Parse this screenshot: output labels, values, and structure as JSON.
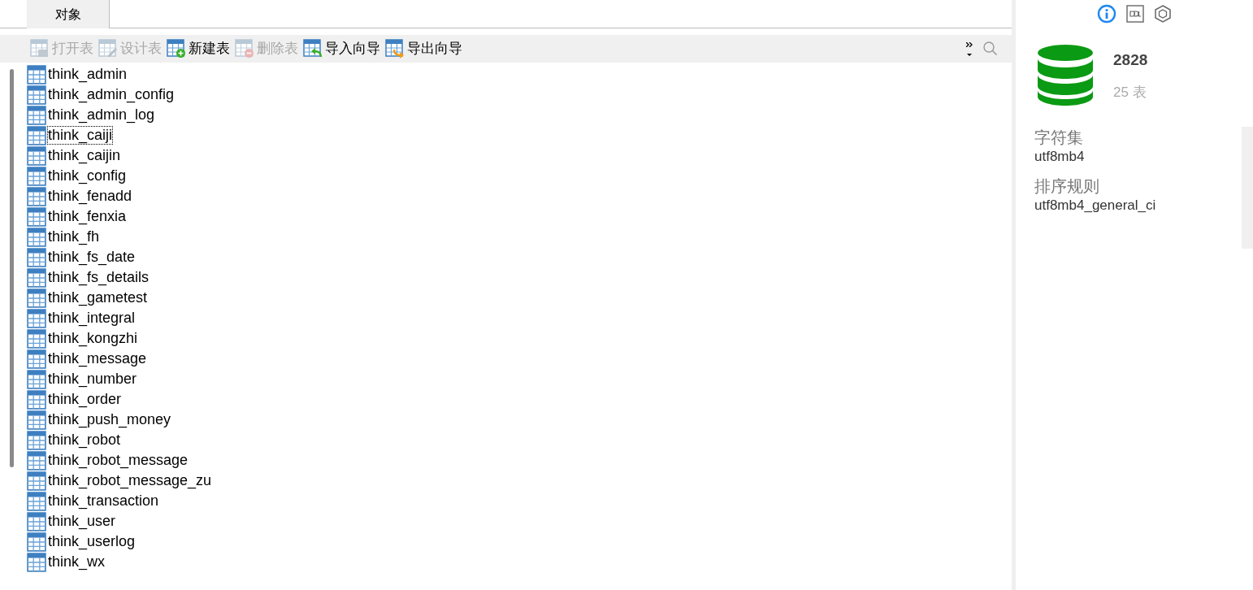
{
  "tabs": [
    {
      "label": "对象",
      "selected": true
    }
  ],
  "toolbar": [
    {
      "kind": "open",
      "label": "打开表",
      "disabled": true
    },
    {
      "kind": "design",
      "label": "设计表",
      "disabled": true
    },
    {
      "kind": "new",
      "label": "新建表",
      "disabled": false
    },
    {
      "kind": "delete",
      "label": "删除表",
      "disabled": true
    },
    {
      "kind": "import",
      "label": "导入向导",
      "disabled": false
    },
    {
      "kind": "export",
      "label": "导出向导",
      "disabled": false
    }
  ],
  "tables": [
    {
      "name": "think_admin",
      "focused": false
    },
    {
      "name": "think_admin_config",
      "focused": false
    },
    {
      "name": "think_admin_log",
      "focused": false
    },
    {
      "name": "think_caiji",
      "focused": true
    },
    {
      "name": "think_caijin",
      "focused": false
    },
    {
      "name": "think_config",
      "focused": false
    },
    {
      "name": "think_fenadd",
      "focused": false
    },
    {
      "name": "think_fenxia",
      "focused": false
    },
    {
      "name": "think_fh",
      "focused": false
    },
    {
      "name": "think_fs_date",
      "focused": false
    },
    {
      "name": "think_fs_details",
      "focused": false
    },
    {
      "name": "think_gametest",
      "focused": false
    },
    {
      "name": "think_integral",
      "focused": false
    },
    {
      "name": "think_kongzhi",
      "focused": false
    },
    {
      "name": "think_message",
      "focused": false
    },
    {
      "name": "think_number",
      "focused": false
    },
    {
      "name": "think_order",
      "focused": false
    },
    {
      "name": "think_push_money",
      "focused": false
    },
    {
      "name": "think_robot",
      "focused": false
    },
    {
      "name": "think_robot_message",
      "focused": false
    },
    {
      "name": "think_robot_message_zu",
      "focused": false
    },
    {
      "name": "think_transaction",
      "focused": false
    },
    {
      "name": "think_user",
      "focused": false
    },
    {
      "name": "think_userlog",
      "focused": false
    },
    {
      "name": "think_wx",
      "focused": false
    }
  ],
  "info_panel": {
    "tabs": [
      {
        "kind": "info",
        "selected": true
      },
      {
        "kind": "ddl",
        "selected": false
      },
      {
        "kind": "hexagon",
        "selected": false
      }
    ],
    "database": {
      "name": "2828",
      "count": "25 表"
    },
    "fields": [
      {
        "label": "字符集",
        "value": "utf8mb4"
      },
      {
        "label": "排序规则",
        "value": "utf8mb4_general_ci"
      }
    ]
  }
}
